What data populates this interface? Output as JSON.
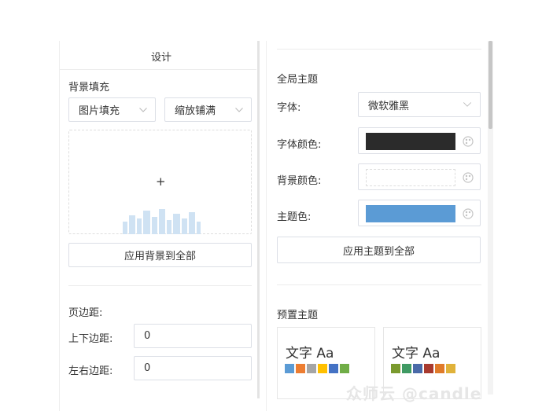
{
  "left": {
    "title": "设计",
    "bg_fill_label": "背景填充",
    "fill_type": "图片填充",
    "fill_mode": "缩放铺满",
    "upload_plus": "+",
    "apply_bg_label": "应用背景到全部",
    "margin_label": "页边距:",
    "tb_margin_label": "上下边距:",
    "tb_margin_value": "0",
    "lr_margin_label": "左右边距:",
    "lr_margin_value": "0"
  },
  "right": {
    "global_theme_label": "全局主题",
    "font_label": "字体:",
    "font_value": "微软雅黑",
    "font_color_label": "字体颜色:",
    "font_color": "#2b2b2b",
    "bg_color_label": "背景颜色:",
    "bg_color": "#ffffff",
    "theme_color_label": "主题色:",
    "theme_color": "#5b9bd5",
    "apply_theme_label": "应用主题到全部",
    "preset_label": "预置主题",
    "presets": [
      {
        "title": "文字 Aa",
        "colors": [
          "#5b9bd5",
          "#ed7d31",
          "#a5a5a5",
          "#ffc000",
          "#4472c4",
          "#70ad47"
        ]
      },
      {
        "title": "文字 Aa",
        "colors": [
          "#7a9a2e",
          "#3f9a63",
          "#4a6aa8",
          "#a83a2f",
          "#e07b2a",
          "#e0b23a"
        ]
      }
    ]
  },
  "watermark": "众师云 @candle"
}
